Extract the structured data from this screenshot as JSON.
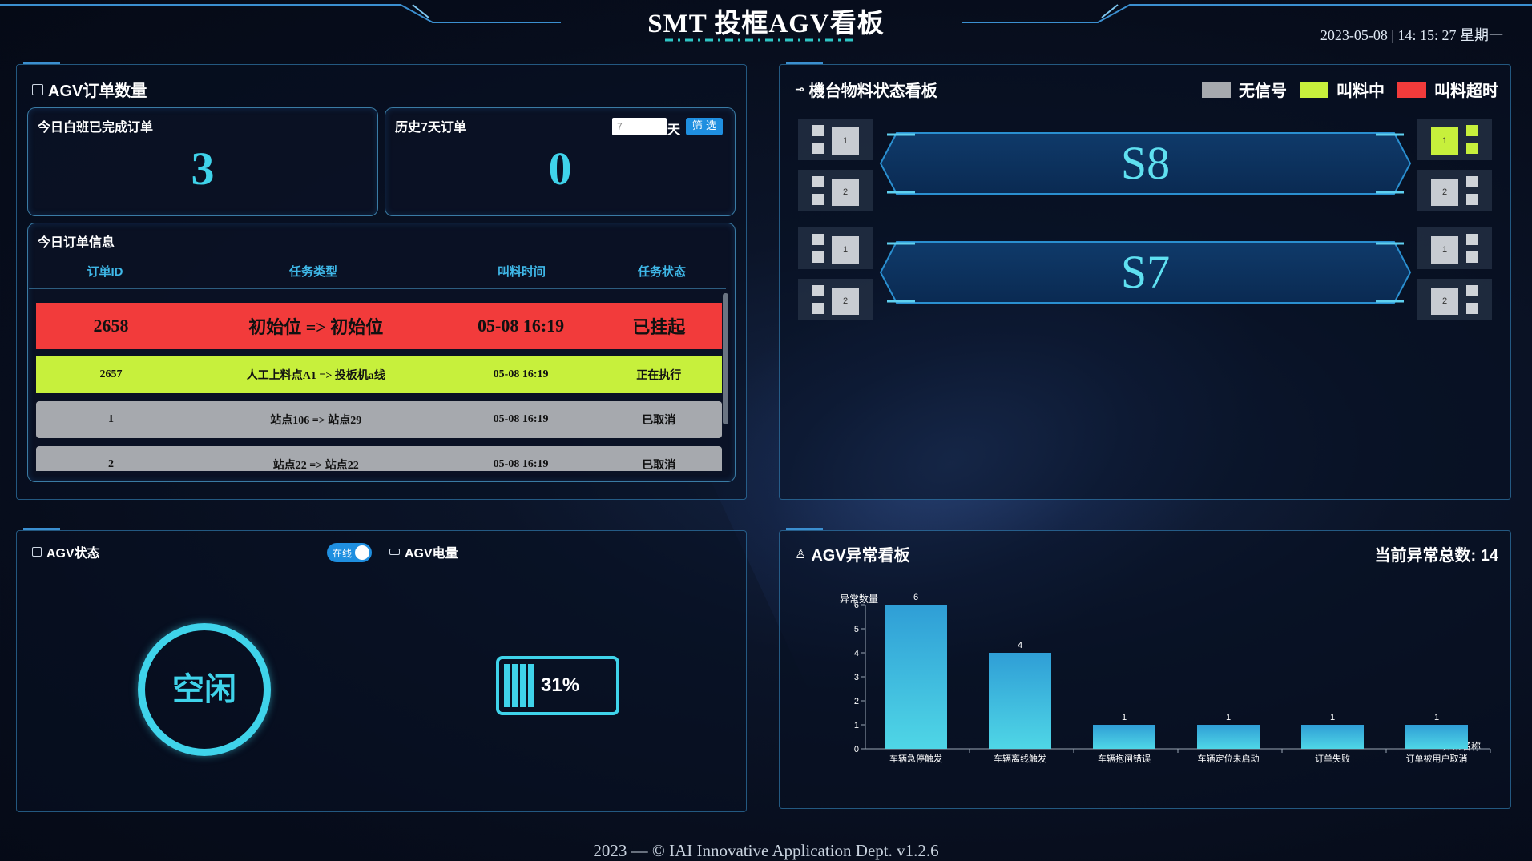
{
  "header": {
    "title": "SMT 投框AGV看板",
    "datetime": "2023-05-08 | 14: 15: 27 星期一"
  },
  "footer": "2023 — © IAI Innovative Application Dept. v1.2.6",
  "orders_panel": {
    "title": "AGV订单数量",
    "today_card": {
      "title": "今日白班已完成订单",
      "value": "3"
    },
    "history_card": {
      "title": "历史7天订单",
      "days_input": "7",
      "days_unit": "天",
      "filter_button": "筛 选",
      "value": "0"
    }
  },
  "order_info": {
    "title": "今日订单信息",
    "columns": [
      "订单ID",
      "任务类型",
      "叫料时间",
      "任务状态"
    ],
    "rows": [
      {
        "id": "2658",
        "type": "初始位 => 初始位",
        "time": "05-08 16:19",
        "status": "已挂起",
        "color": "#f23b3b"
      },
      {
        "id": "2657",
        "type": "人工上料点A1 => 投板机a线",
        "time": "05-08 16:19",
        "status": "正在执行",
        "color": "#c7f03c"
      },
      {
        "id": "1",
        "type": "站点106 => 站点29",
        "time": "05-08 16:19",
        "status": "已取消",
        "color": "#a6a9ae"
      },
      {
        "id": "2",
        "type": "站点22 => 站点22",
        "time": "05-08 16:19",
        "status": "已取消",
        "color": "#a6a9ae"
      }
    ]
  },
  "machine_board": {
    "title": "機台物料状态看板",
    "legend": [
      {
        "label": "无信号",
        "color": "#a6a9ae"
      },
      {
        "label": "叫料中",
        "color": "#c7f03c"
      },
      {
        "label": "叫料超时",
        "color": "#f23b3b"
      }
    ],
    "machines": [
      {
        "name": "S8",
        "left_slots": [
          "1",
          "2"
        ],
        "right_slots": [
          "1",
          "2"
        ],
        "right_active": [
          true,
          false
        ]
      },
      {
        "name": "S7",
        "left_slots": [
          "1",
          "2"
        ],
        "right_slots": [
          "1",
          "2"
        ],
        "right_active": [
          false,
          false
        ]
      }
    ]
  },
  "agv_status": {
    "title": "AGV状态",
    "toggle_label": "在线",
    "state": "空闲",
    "battery_title": "AGV电量",
    "battery_percent": "31%",
    "battery_level": 0.31
  },
  "anomaly": {
    "title": "AGV异常看板",
    "total_label": "当前异常总数: 14"
  },
  "chart_data": {
    "type": "bar",
    "ylabel": "异常数量",
    "xlabel": "异常名称",
    "ylim": [
      0,
      6
    ],
    "yticks": [
      "0",
      "1",
      "2",
      "3",
      "4",
      "5",
      "6"
    ],
    "categories": [
      "车辆急停触发",
      "车辆离线触发",
      "车辆抱闸错误",
      "车辆定位未启动",
      "订单失败",
      "订单被用户取消"
    ],
    "values": [
      6,
      4,
      1,
      1,
      1,
      1
    ]
  }
}
